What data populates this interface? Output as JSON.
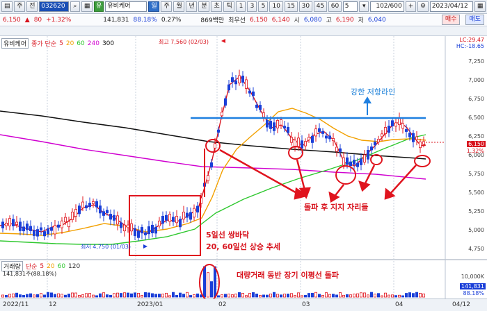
{
  "toolbar": {
    "items": [
      "주",
      "전"
    ],
    "code": "032620",
    "name_tag": "유",
    "name": "유비케어",
    "period_active": "일",
    "periods": [
      "주",
      "월",
      "년",
      "분",
      "초",
      "틱"
    ],
    "intervals": [
      "1",
      "3",
      "5",
      "10",
      "15",
      "30",
      "45",
      "60"
    ],
    "interval_value": "5",
    "count": "102/600",
    "date": "2023/04/12"
  },
  "quote": {
    "price": "6,150",
    "change": "80",
    "change_pct": "+1.32%",
    "volume": "141,831",
    "vol_ratio": "88.18%",
    "turnover": "0.27%",
    "amount": "869백만",
    "best_ask_label": "최우선",
    "best_ask": "6,150",
    "best_bid": "6,140",
    "open_label": "시",
    "open": "6,080",
    "high_label": "고",
    "high": "6,190",
    "low_label": "저",
    "low": "6,040",
    "buy_label": "매수",
    "sell_label": "매도"
  },
  "price_panel": {
    "name": "유비케어",
    "legend_label": "종가 단순",
    "ma": [
      {
        "period": "5",
        "color": "#d8141e"
      },
      {
        "period": "20",
        "color": "#f2a000"
      },
      {
        "period": "60",
        "color": "#2fc82f"
      },
      {
        "period": "240",
        "color": "#d000d0"
      },
      {
        "period": "300",
        "color": "#111111"
      }
    ],
    "lc": "LC:29.47",
    "hc": "HC:-18.65",
    "high_note": "최고 7,560 (02/03)",
    "low_note": "최저 4,750 (01/03)",
    "last_price": "6,150",
    "last_pct": "1.32%",
    "y_ticks": [
      "7,250",
      "7,000",
      "6,750",
      "6,500",
      "6,250",
      "6,000",
      "5,750",
      "5,500",
      "5,250",
      "5,000",
      "4,750"
    ],
    "resistance_label": "강한 저항라인",
    "support_label": "돌파 후 지지 자리들",
    "box_label1": "5일선 쌍바닥",
    "box_label2": "20, 60일선 상승 추세",
    "volume_label": "대량거래 동반 장기 이평선 돌파"
  },
  "volume_panel": {
    "legend_label": "거래량",
    "legend_simple": "단순",
    "ma": [
      {
        "period": "5",
        "color": "#d8141e"
      },
      {
        "period": "20",
        "color": "#f2a000"
      },
      {
        "period": "60",
        "color": "#2fc82f"
      },
      {
        "period": "120",
        "color": "#333333"
      }
    ],
    "vol_text": "141,831주(88.18%)",
    "y_tick": "10,000K",
    "last_vol": "141,831",
    "last_pct": "88.18%"
  },
  "x_axis": [
    "2022/11",
    "12",
    "2023/01",
    "02",
    "03",
    "04",
    "04/12"
  ]
}
